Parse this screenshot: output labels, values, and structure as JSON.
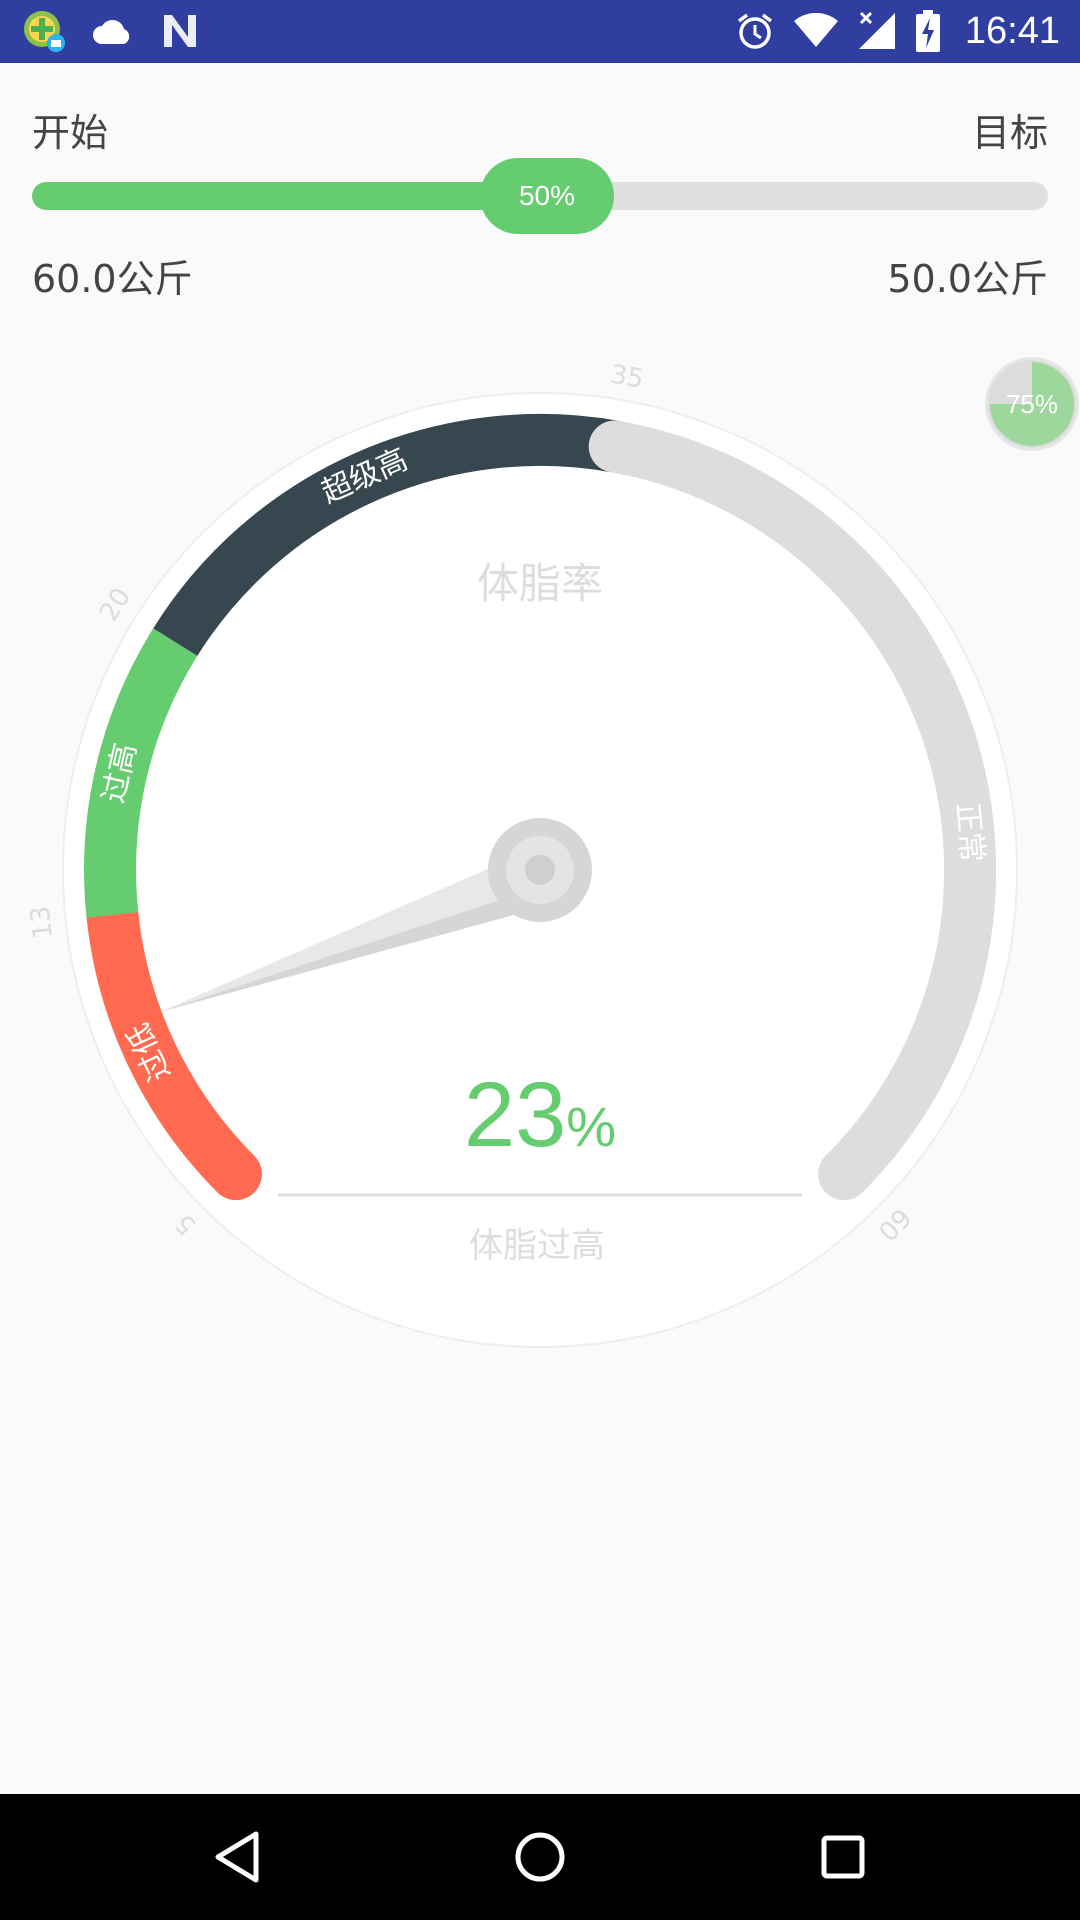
{
  "status_bar": {
    "time": "16:41",
    "left_icons": [
      "app-plus-icon",
      "cloud-icon",
      "n-logo-icon"
    ],
    "right_icons": [
      "alarm-icon",
      "wifi-icon",
      "signal-icon",
      "battery-charging-icon"
    ]
  },
  "progress": {
    "start_label": "开始",
    "target_label": "目标",
    "start_value": "60.0公斤",
    "target_value": "50.0公斤",
    "percent_label": "50%",
    "percent": 0.5,
    "fill_color": "#66cc70",
    "track_color": "#e0e0e0"
  },
  "badge": {
    "label": "75%",
    "level": 0.75
  },
  "gauge": {
    "title": "体脂率",
    "value": "23",
    "unit": "%",
    "status": "体脂过高",
    "value_color": "#66cc70",
    "ticks": [
      "5",
      "13",
      "20",
      "35",
      "60"
    ],
    "segments": [
      {
        "label": "过低",
        "color": "#ff6a50"
      },
      {
        "label": "过高",
        "color": "#66cc70"
      },
      {
        "label": "超级高",
        "color": "#37474f"
      },
      {
        "label": "正常",
        "color": "#dddddd"
      }
    ]
  },
  "nav": {
    "icons": [
      "back-icon",
      "home-icon",
      "recents-icon"
    ]
  }
}
